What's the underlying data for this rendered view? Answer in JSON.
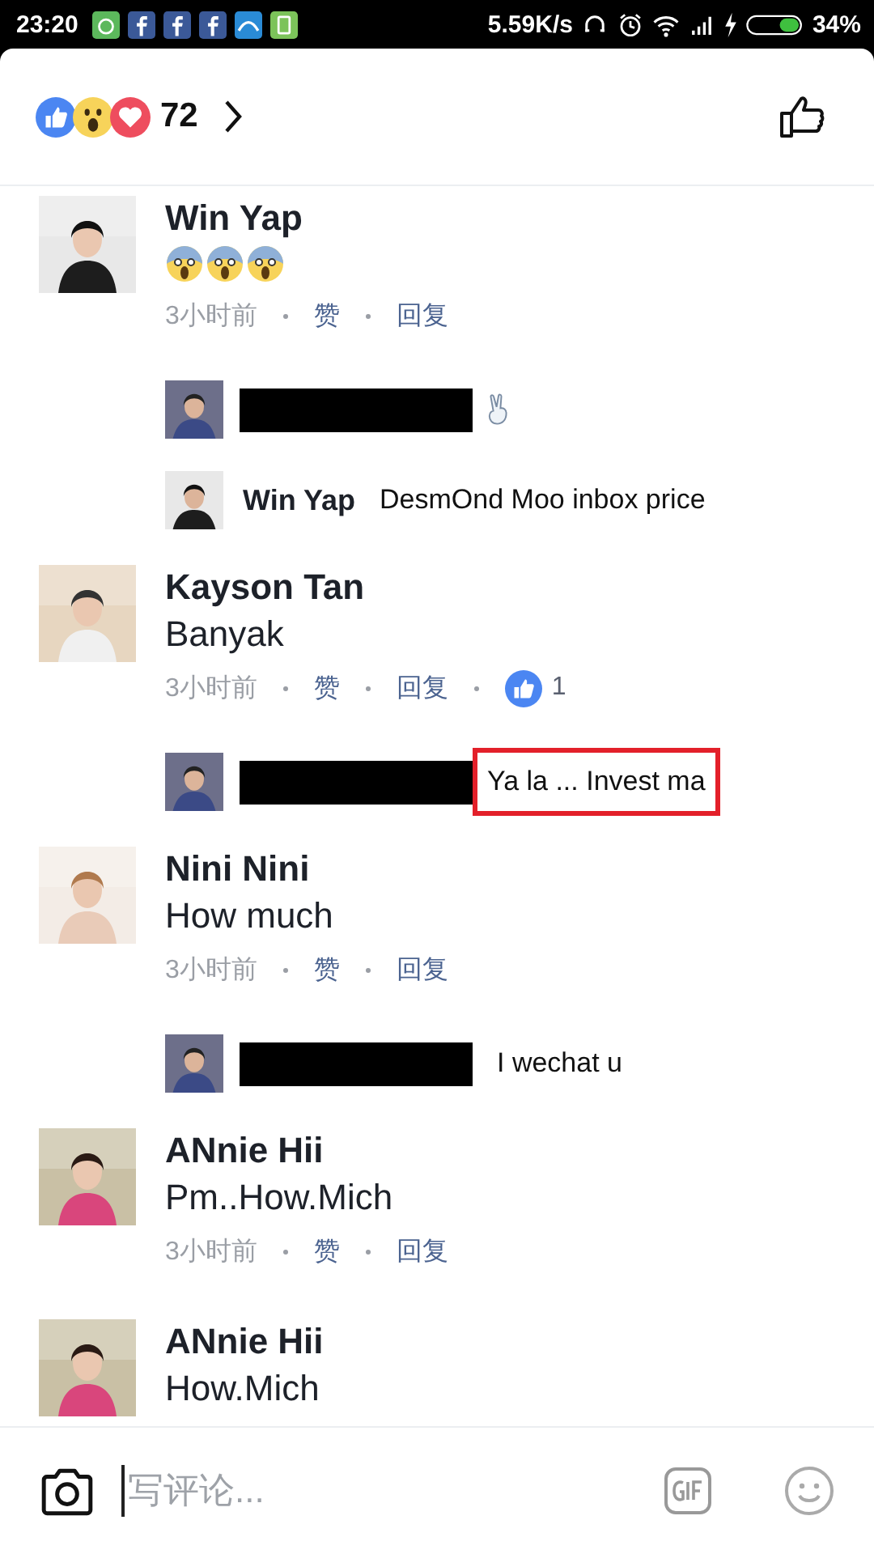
{
  "status_bar": {
    "time": "23:20",
    "speed": "5.59K/s",
    "battery": "34%"
  },
  "header": {
    "count": "72"
  },
  "comments": [
    {
      "kind": "comment",
      "name": "Win Yap",
      "scream_emojis": true,
      "time": "3小时前",
      "like": "赞",
      "reply": "回复"
    },
    {
      "kind": "reply",
      "redacted": true,
      "victory_hand": true
    },
    {
      "kind": "reply",
      "redacted": false,
      "name": "Win Yap",
      "body": "DesmOnd Moo inbox price"
    },
    {
      "kind": "comment",
      "name": "Kayson Tan",
      "body": "Banyak",
      "time": "3小时前",
      "like": "赞",
      "reply": "回复",
      "likes": "1"
    },
    {
      "kind": "reply",
      "redacted": true,
      "body": "Ya la ... Invest ma",
      "highlighted": true
    },
    {
      "kind": "comment",
      "name": "Nini Nini",
      "body": "How much",
      "time": "3小时前",
      "like": "赞",
      "reply": "回复"
    },
    {
      "kind": "reply",
      "redacted": true,
      "body": "I wechat u"
    },
    {
      "kind": "comment",
      "name": "ANnie Hii",
      "body": "Pm..How.Mich",
      "time": "3小时前",
      "like": "赞",
      "reply": "回复"
    },
    {
      "kind": "comment",
      "name": "ANnie Hii",
      "body": "How.Mich"
    }
  ],
  "composer": {
    "placeholder": "写评论..."
  }
}
